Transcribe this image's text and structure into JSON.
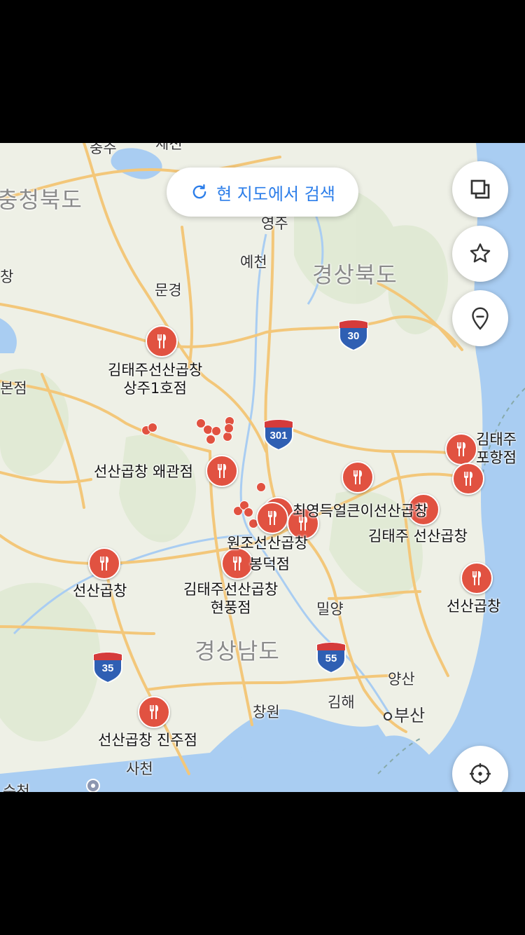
{
  "search": {
    "label": "현 지도에서 검색",
    "icon": "refresh-icon",
    "color": "#2b7de9"
  },
  "controls": [
    {
      "name": "layers-button",
      "icon": "layers-icon"
    },
    {
      "name": "favorites-button",
      "icon": "star-icon"
    },
    {
      "name": "location-pin-button",
      "icon": "pin-icon"
    },
    {
      "name": "my-location-button",
      "icon": "crosshair-icon"
    }
  ],
  "regions": {
    "chungbuk": "충청북도",
    "gyeongbuk": "경상북도",
    "gyeongnam": "경상남도"
  },
  "cities": {
    "chungju": "충주",
    "jecheon": "제천",
    "yeongju": "영주",
    "yecheon": "예천",
    "mungyeong": "문경",
    "miryang": "밀양",
    "yangsan": "양산",
    "gimhae": "김해",
    "busan": "부산",
    "changwon": "창원",
    "sacheon": "사천",
    "edge_left_1": "창",
    "edge_left_2": "본점",
    "edge_bottom": "순천"
  },
  "highways": [
    "30",
    "301",
    "35",
    "55"
  ],
  "restaurants": [
    {
      "line1": "김태주선산곱창",
      "line2": "상주1호점"
    },
    {
      "line1": "선산곱창 왜관점",
      "line2": ""
    },
    {
      "line1": "최영득얼큰이선산곱창",
      "line2": ""
    },
    {
      "line1": "원조선산곱창",
      "line2": ""
    },
    {
      "line1": "봉덕점",
      "line2": ""
    },
    {
      "line1": "김태주선산곱창",
      "line2": "현풍점"
    },
    {
      "line1": "선산곱창",
      "line2": ""
    },
    {
      "line1": "김태주 선산곱창",
      "line2": ""
    },
    {
      "line1": "김태주",
      "line2": "포항점"
    },
    {
      "line1": "선산곱창",
      "line2": ""
    },
    {
      "line1": "선산곱창 진주점",
      "line2": ""
    }
  ],
  "colors": {
    "marker": "#e15241",
    "road": "#f3c77a",
    "water": "#a9cdf2",
    "land": "#eef0e6",
    "highway_shield": "#2f5fb3"
  }
}
